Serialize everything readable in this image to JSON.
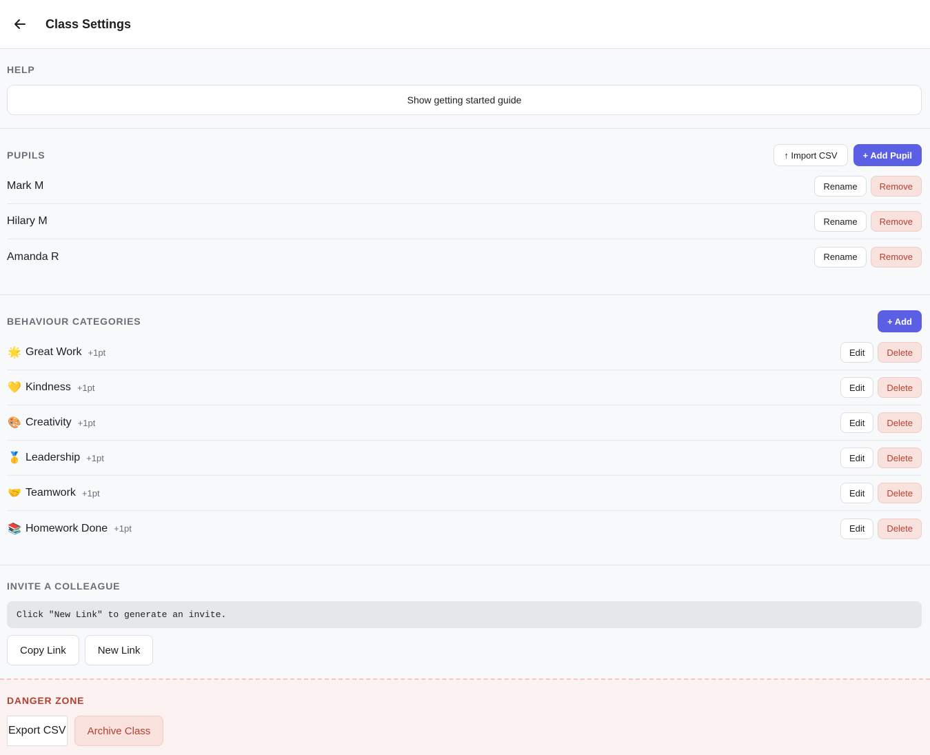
{
  "header": {
    "title": "Class Settings",
    "back_icon": "arrow-left-icon"
  },
  "help": {
    "label": "HELP",
    "guide_button": "Show getting started guide"
  },
  "pupils": {
    "label": "PUPILS",
    "import_button": "↑ Import CSV",
    "add_button": "+ Add Pupil",
    "rename_label": "Rename",
    "remove_label": "Remove",
    "items": [
      {
        "name": "Mark M"
      },
      {
        "name": "Hilary M"
      },
      {
        "name": "Amanda R"
      }
    ]
  },
  "behaviour": {
    "label": "BEHAVIOUR CATEGORIES",
    "add_button": "+ Add",
    "edit_label": "Edit",
    "delete_label": "Delete",
    "items": [
      {
        "emoji": "🌟",
        "name": "Great Work",
        "points": "+1pt"
      },
      {
        "emoji": "💛",
        "name": "Kindness",
        "points": "+1pt"
      },
      {
        "emoji": "🎨",
        "name": "Creativity",
        "points": "+1pt"
      },
      {
        "emoji": "🥇",
        "name": "Leadership",
        "points": "+1pt"
      },
      {
        "emoji": "🤝",
        "name": "Teamwork",
        "points": "+1pt"
      },
      {
        "emoji": "📚",
        "name": "Homework Done",
        "points": "+1pt"
      }
    ]
  },
  "invite": {
    "label": "INVITE A COLLEAGUE",
    "message": "Click \"New Link\" to generate an invite.",
    "copy_button": "Copy Link",
    "new_button": "New Link"
  },
  "danger": {
    "label": "DANGER ZONE",
    "export_button": "Export CSV",
    "archive_button": "Archive Class"
  },
  "colors": {
    "primary": "#5b5fe3",
    "danger": "#b5402f",
    "danger_bg": "#f9e1de"
  }
}
